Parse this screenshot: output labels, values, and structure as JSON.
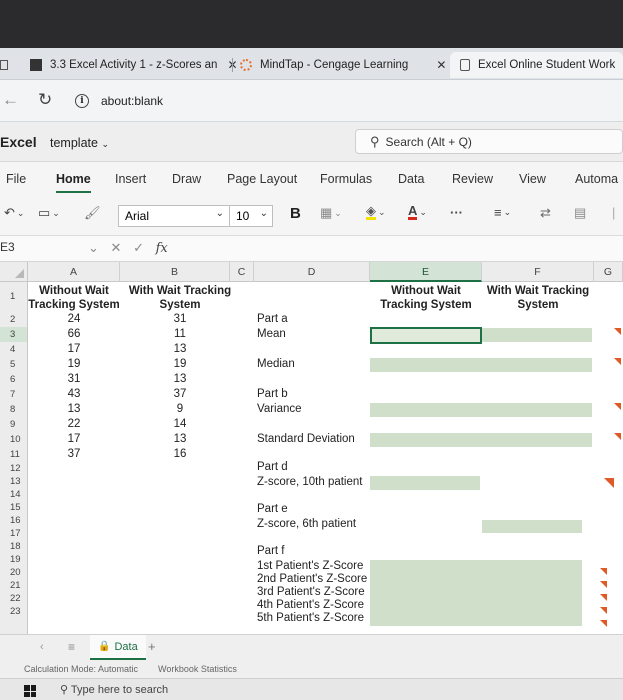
{
  "browser": {
    "tabs": [
      {
        "label": "3.3 Excel Activity 1 - z-Scores an",
        "close": "✕"
      },
      {
        "label": "MindTap - Cengage Learning",
        "close": "✕"
      },
      {
        "label": "Excel Online Student Work"
      }
    ],
    "url": "about:blank"
  },
  "excel": {
    "app_name": "Excel",
    "doc_name": "template",
    "search_placeholder": "Search (Alt + Q)",
    "ribbon_tabs": [
      "File",
      "Home",
      "Insert",
      "Draw",
      "Page Layout",
      "Formulas",
      "Data",
      "Review",
      "View",
      "Automa"
    ],
    "active_tab": "Home",
    "font_name": "Arial",
    "font_size": "10",
    "bold_label": "B",
    "more_label": "···",
    "name_box": "E3",
    "fx_label": "fx"
  },
  "grid": {
    "columns": [
      "A",
      "B",
      "C",
      "D",
      "E",
      "F",
      "G"
    ],
    "rows": [
      "1",
      "2",
      "3",
      "4",
      "5",
      "6",
      "7",
      "8",
      "9",
      "10",
      "11",
      "12",
      "13",
      "14",
      "15",
      "16",
      "17",
      "18",
      "19",
      "20",
      "21",
      "22",
      "23"
    ],
    "header_A": [
      "Without Wait",
      "Tracking System"
    ],
    "header_B": [
      "With Wait Tracking",
      "System"
    ],
    "header_E": [
      "Without Wait",
      "Tracking System"
    ],
    "header_F": [
      "With Wait Tracking",
      "System"
    ],
    "col_a_values": [
      "24",
      "66",
      "17",
      "19",
      "31",
      "43",
      "13",
      "22",
      "17",
      "37"
    ],
    "col_b_values": [
      "31",
      "11",
      "13",
      "19",
      "13",
      "37",
      "9",
      "14",
      "13",
      "16"
    ],
    "labels": {
      "part_a": "Part a",
      "mean": "Mean",
      "median": "Median",
      "part_b": "Part b",
      "variance": "Variance",
      "std_dev": "Standard Deviation",
      "part_d": "Part d",
      "z10": "Z-score, 10th patient",
      "part_e": "Part e",
      "z6": "Z-score, 6th patient",
      "part_f": "Part f",
      "z1": "1st Patient's Z-Score",
      "z2": "2nd Patient's Z-Score",
      "z3": "3rd Patient's Z-Score",
      "z4": "4th Patient's Z-Score",
      "z5": "5th Patient's Z-Score"
    }
  },
  "sheet": {
    "tab_label": "Data",
    "add_label": "+",
    "status_calc": "Calculation Mode: Automatic",
    "status_stats": "Workbook Statistics"
  },
  "taskbar": {
    "search_text": "Type here to search"
  },
  "colors": {
    "accent": "#1e7145",
    "input_fill": "#cfdfc9"
  }
}
